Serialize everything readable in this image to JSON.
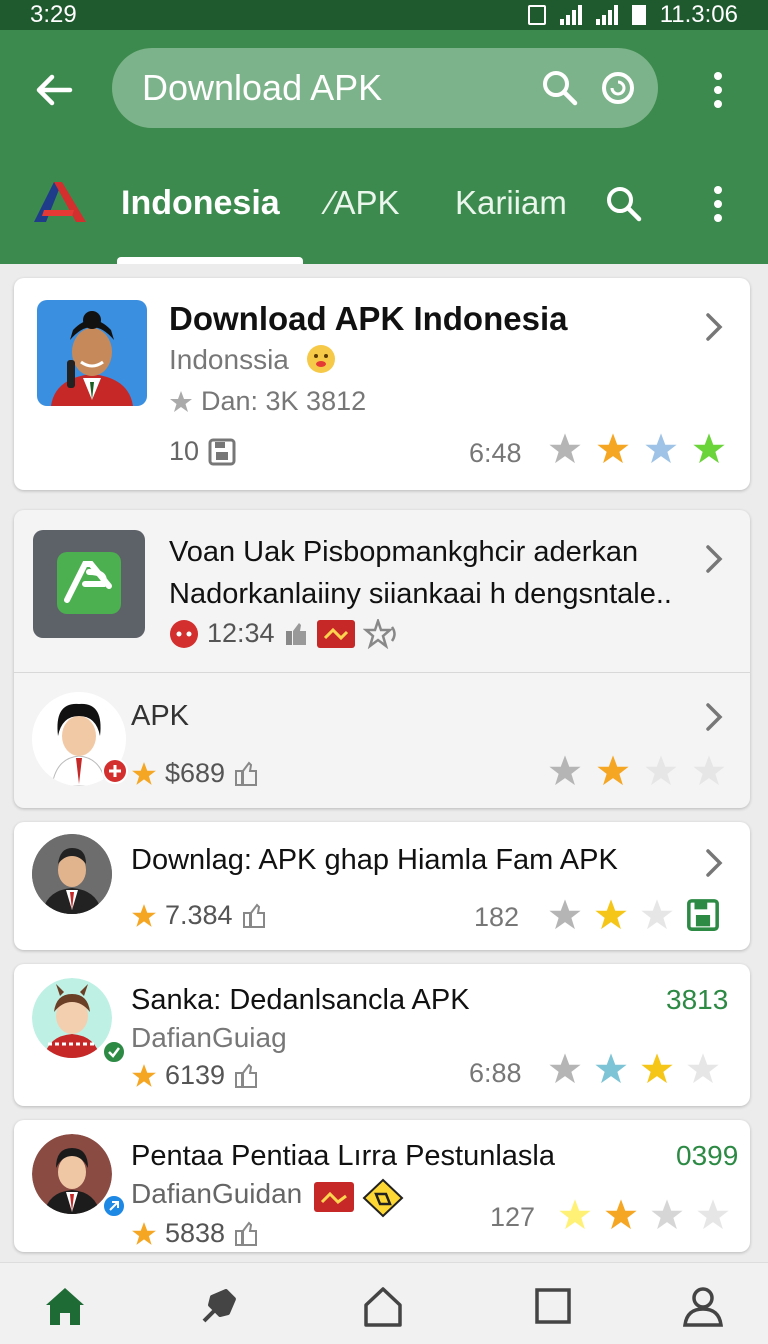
{
  "status": {
    "time": "3:29",
    "clock_right": "11.3:06"
  },
  "appbar": {
    "search_text": "Download APK",
    "tabs": [
      "Indonesia",
      "⁄APK",
      "Kariiam"
    ]
  },
  "featured": {
    "title": "Download APK Indonesia",
    "subtitle": "Indonssia",
    "rating_text": "Dan: 3K 3812",
    "count": "10",
    "score": "6:48"
  },
  "promo": {
    "line1": "Voan Uak Pisbopmankghcir aderkan",
    "line2": "Nadorkanlaiiny siiankaai h dengsntale..",
    "time": "12:34"
  },
  "items": [
    {
      "title": "APK",
      "rating": "$689"
    },
    {
      "title": "Downlag: APK ghap Hiamla Fam APK",
      "rating": "7.384",
      "count": "182"
    },
    {
      "title": "Sanka: Dedanlsancla APK",
      "subtitle": "DafianGuiag",
      "rating": "6139",
      "score": "6:88",
      "price": "3813"
    },
    {
      "title": "Pentaa Pentiaa Lırra Pestunlasla",
      "subtitle": "DafianGuidan",
      "rating": "5838",
      "count": "127",
      "price": "0399"
    }
  ],
  "colors": {
    "appbar": "#3c8a4e",
    "statusbar": "#1f5a2f",
    "accent_green": "#2d8a45",
    "star_gold": "#f5a623",
    "star_gray": "#bdbdbd"
  },
  "icons": [
    "back-arrow-icon",
    "search-icon",
    "mic-icon",
    "more-vert-icon",
    "home-icon",
    "pin-icon",
    "house-outline-icon",
    "square-icon",
    "person-icon"
  ]
}
